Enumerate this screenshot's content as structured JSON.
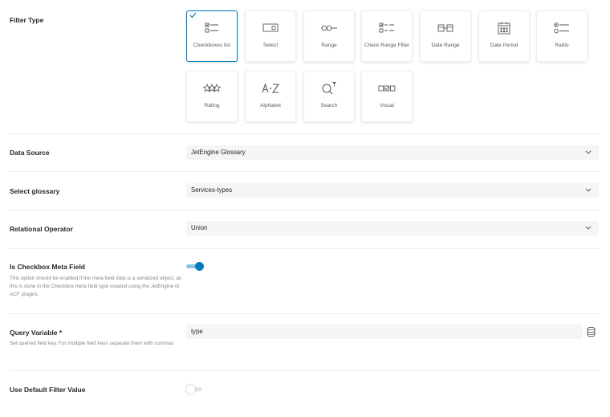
{
  "filter_type": {
    "label": "Filter Type",
    "tiles": [
      {
        "label": "Checkboxes list",
        "icon": "checkboxes-list-icon",
        "selected": true
      },
      {
        "label": "Select",
        "icon": "select-icon",
        "selected": false
      },
      {
        "label": "Range",
        "icon": "range-icon",
        "selected": false
      },
      {
        "label": "Check Range Filter",
        "icon": "check-range-icon",
        "selected": false
      },
      {
        "label": "Date Range",
        "icon": "date-range-icon",
        "selected": false
      },
      {
        "label": "Date Period",
        "icon": "calendar-icon",
        "selected": false
      },
      {
        "label": "Radio",
        "icon": "radio-icon",
        "selected": false
      },
      {
        "label": "Rating",
        "icon": "stars-icon",
        "selected": false
      },
      {
        "label": "Alphabet",
        "icon": "alphabet-icon",
        "selected": false
      },
      {
        "label": "Search",
        "icon": "search-icon",
        "selected": false
      },
      {
        "label": "Visual",
        "icon": "visual-icon",
        "selected": false
      }
    ]
  },
  "data_source": {
    "label": "Data Source",
    "value": "JetEngine Glossary"
  },
  "select_glossary": {
    "label": "Select glossary",
    "value": "Services-types"
  },
  "relational_operator": {
    "label": "Relational Operator",
    "value": "Union"
  },
  "checkbox_meta": {
    "label": "Is Checkbox Meta Field",
    "description": "This option should be enabled if the meta field data is a serialized object, as this is done in the Checkbox meta field type created using the JetEngine or ACF plugins.",
    "enabled": true
  },
  "query_variable": {
    "label": "Query Variable *",
    "description": "Set queried field key. For multiple field keys separate them with commas",
    "value": "type"
  },
  "default_filter": {
    "label": "Use Default Filter Value",
    "enabled": false
  },
  "colors": {
    "accent": "#007cba",
    "field_bg": "#f5f5f5",
    "muted_text": "#7e8993"
  }
}
